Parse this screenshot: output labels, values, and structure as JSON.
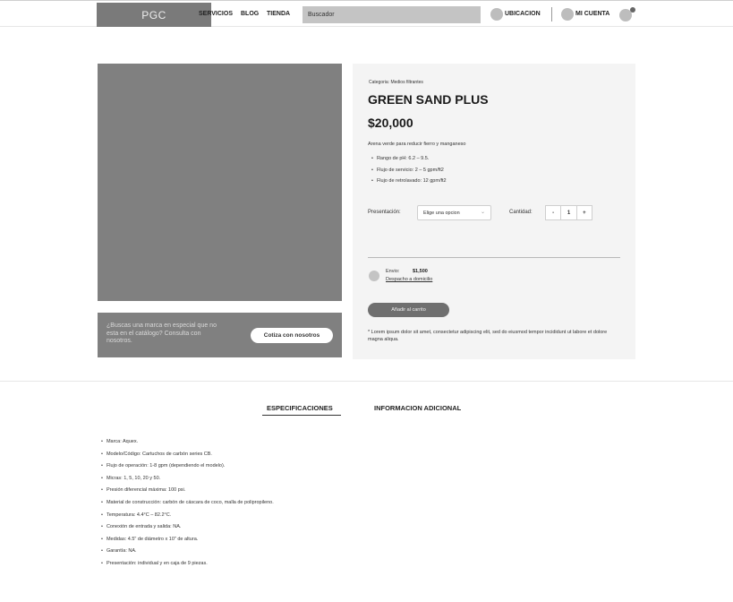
{
  "header": {
    "logo": "PGC",
    "nav": [
      "SERVICIOS",
      "BLOG",
      "TIENDA"
    ],
    "search_placeholder": "Buscador",
    "location_label": "UBICACION",
    "account_label": "MI CUENTA"
  },
  "promo": {
    "text": "¿Buscas una marca en especial que no esta en el catálogo? Consulta con nosotros.",
    "button": "Cotiza con nosotros"
  },
  "product": {
    "category": "Categoria: Medios filtrantes",
    "title": "GREEN SAND PLUS",
    "price": "$20,000",
    "description": "Arena verde para reducir fierro y manganeso",
    "features": [
      "Rango de pH: 6.2 – 9.5.",
      "Flujo de servicio: 2 – 5 gpm/ft2",
      "Flujo de retrolavado: 12 gpm/ft2"
    ],
    "presentation_label": "Presentación:",
    "presentation_value": "Elige una opcion",
    "quantity_label": "Cantidad:",
    "quantity_minus": "-",
    "quantity_value": "1",
    "quantity_plus": "+",
    "shipping_label": "Envio:",
    "shipping_price": "$1,500",
    "shipping_link": "Despacho a domicilio",
    "add_to_cart": "Añadir al carrito",
    "note": "*  Lorem ipsum dolor sit amet, consectetur adipiscing elit, sed do eiusmod tempor incididunt ut labore et dolore magna aliqua."
  },
  "tabs": {
    "active": "ESPECIFICACIONES",
    "other": "INFORMACION ADICIONAL"
  },
  "specs": [
    "Marca: Aquex.",
    "Modelo/Código: Cartuchos de carbón series CB.",
    "Flujo de operación: 1-8 gpm (dependiendo el modelo).",
    "Micras: 1, 5, 10, 20 y 50.",
    "Presión diferencial máxima: 100 psi.",
    "Material de construcción: carbón de cáscara de coco, malla de polipropileno.",
    "Temperatura: 4.4°C – 82.2°C.",
    "Conexión de entrada y salida: NA.",
    "Medidas: 4.5\" de diámetro x 10\" de altura.",
    "Garantía: NA.",
    "Presentación: individual y en caja de 9 piezas."
  ]
}
